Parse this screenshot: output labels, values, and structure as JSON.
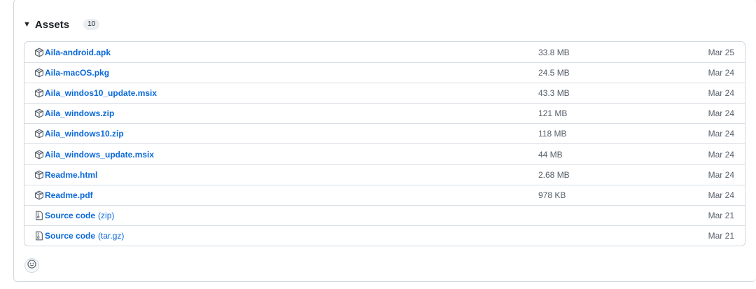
{
  "assets": {
    "title": "Assets",
    "count": "10",
    "items": [
      {
        "name": "Aila-android.apk",
        "suffix": "",
        "size": "33.8 MB",
        "date": "Mar 25",
        "icon": "package-icon"
      },
      {
        "name": "Aila-macOS.pkg",
        "suffix": "",
        "size": "24.5 MB",
        "date": "Mar 24",
        "icon": "package-icon"
      },
      {
        "name": "Aila_windos10_update.msix",
        "suffix": "",
        "size": "43.3 MB",
        "date": "Mar 24",
        "icon": "package-icon"
      },
      {
        "name": "Aila_windows.zip",
        "suffix": "",
        "size": "121 MB",
        "date": "Mar 24",
        "icon": "package-icon"
      },
      {
        "name": "Aila_windows10.zip",
        "suffix": "",
        "size": "118 MB",
        "date": "Mar 24",
        "icon": "package-icon"
      },
      {
        "name": "Aila_windows_update.msix",
        "suffix": "",
        "size": "44 MB",
        "date": "Mar 24",
        "icon": "package-icon"
      },
      {
        "name": "Readme.html",
        "suffix": "",
        "size": "2.68 MB",
        "date": "Mar 24",
        "icon": "package-icon"
      },
      {
        "name": "Readme.pdf",
        "suffix": "",
        "size": "978 KB",
        "date": "Mar 24",
        "icon": "package-icon"
      },
      {
        "name": "Source code",
        "suffix": "(zip)",
        "size": "",
        "date": "Mar 21",
        "icon": "file-zip-icon"
      },
      {
        "name": "Source code",
        "suffix": "(tar.gz)",
        "size": "",
        "date": "Mar 21",
        "icon": "file-zip-icon"
      }
    ]
  },
  "reactions": {
    "icon": "smiley-icon"
  },
  "colors": {
    "link": "#0969da",
    "muted": "#57606a",
    "border": "#d0d7de"
  }
}
